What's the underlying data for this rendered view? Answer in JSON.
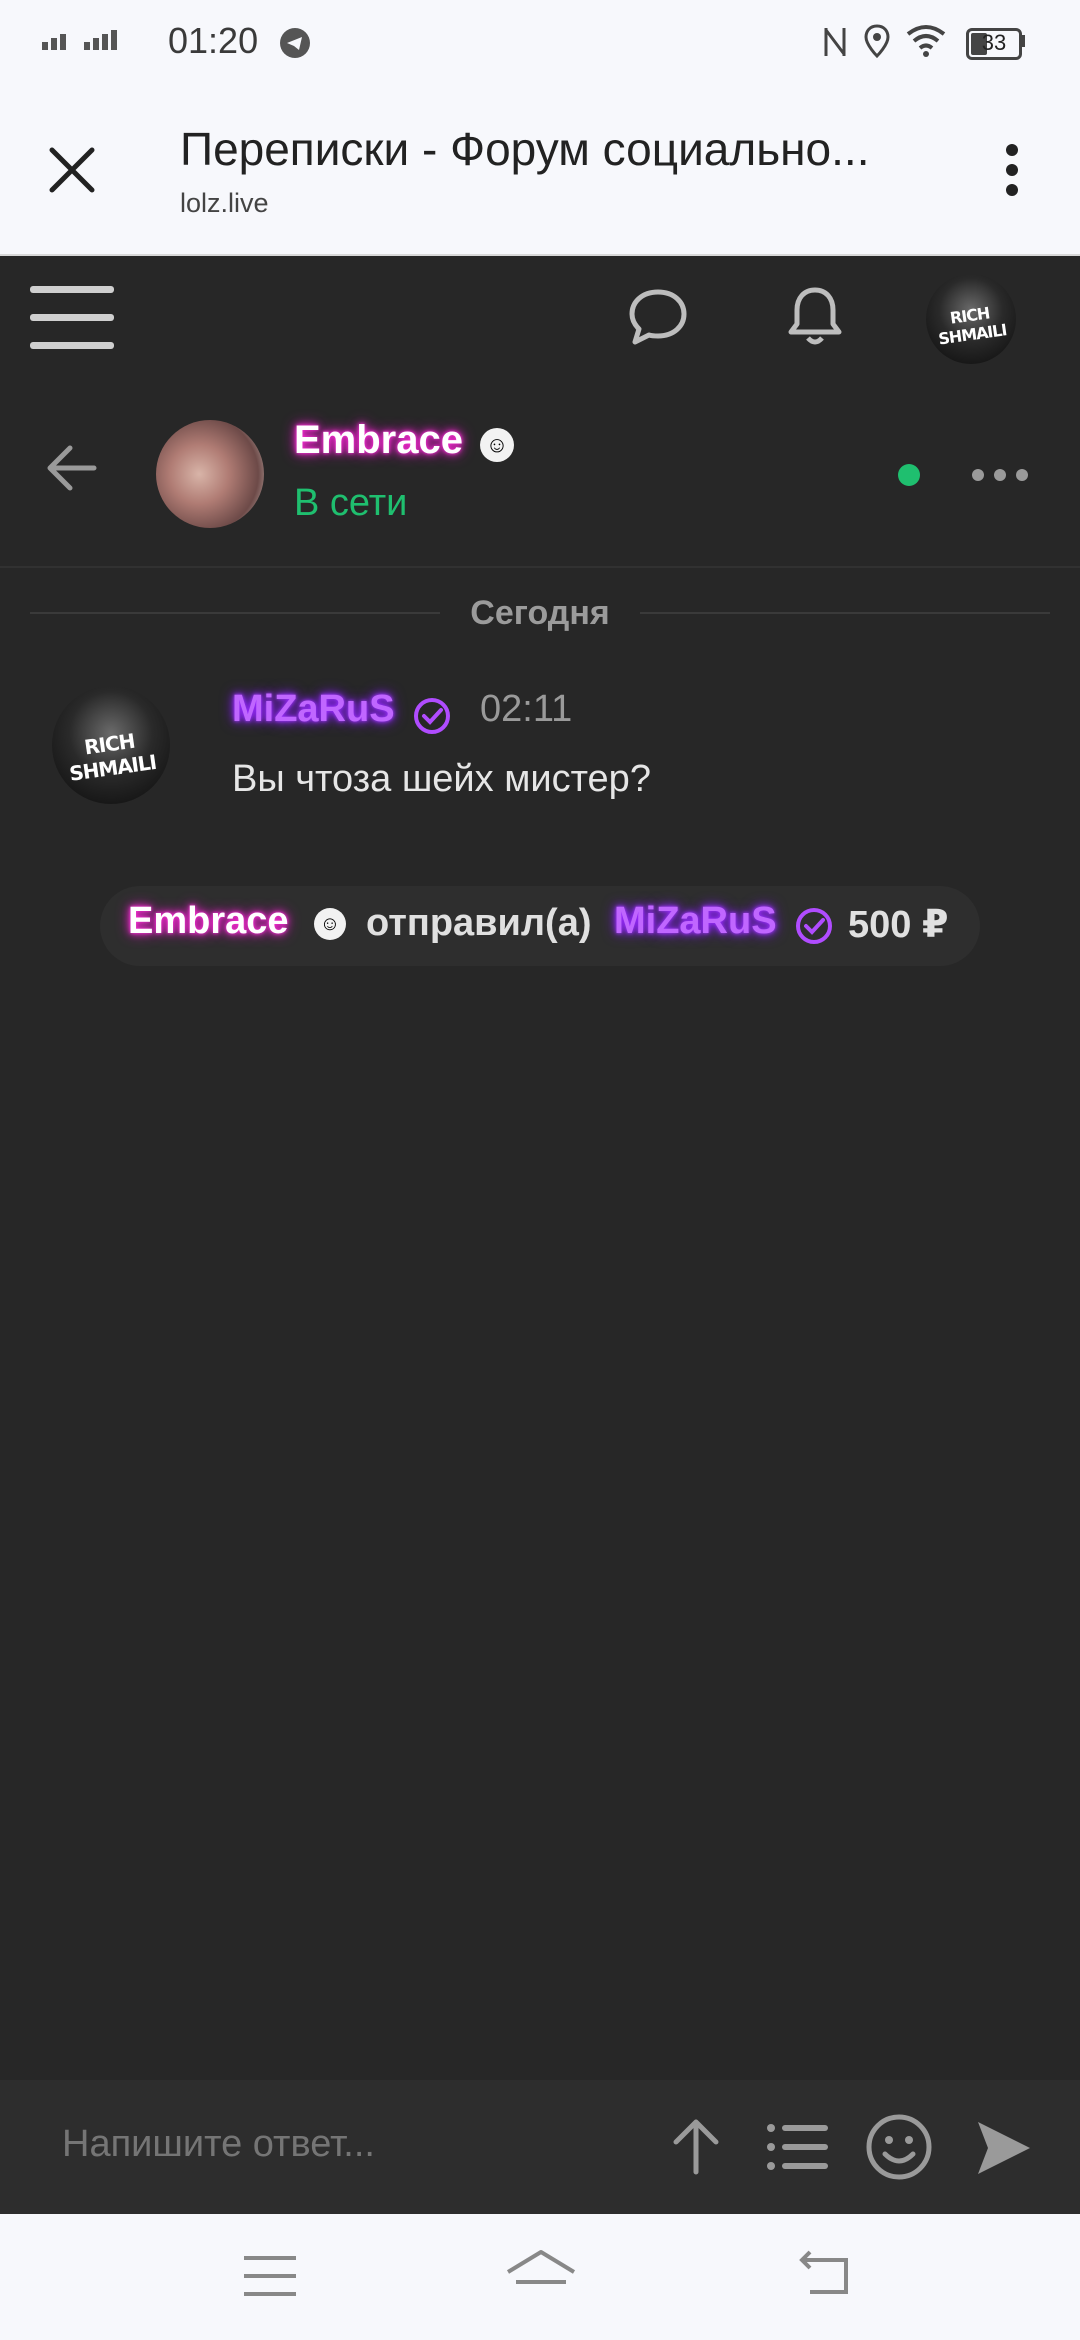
{
  "status_bar": {
    "time": "01:20",
    "battery": "33"
  },
  "browser": {
    "title": "Переписки - Форум социально...",
    "url": "lolz.live"
  },
  "chat": {
    "contact_name": "Embrace",
    "contact_status": "В сети",
    "date_separator": "Сегодня",
    "message": {
      "author": "MiZaRuS",
      "time": "02:11",
      "text": "Вы чтоза шейх мистер?"
    },
    "transfer": {
      "sender": "Embrace",
      "action": "отправил(а)",
      "recipient": "MiZaRuS",
      "amount": "500 ₽"
    }
  },
  "avatar_text": "RICH SHMAILI",
  "input": {
    "placeholder": "Напишите ответ..."
  },
  "colors": {
    "online": "#1fbf6f",
    "accent_pink": "#ff2fd5",
    "accent_purple": "#9b2cff",
    "background": "#272727"
  }
}
